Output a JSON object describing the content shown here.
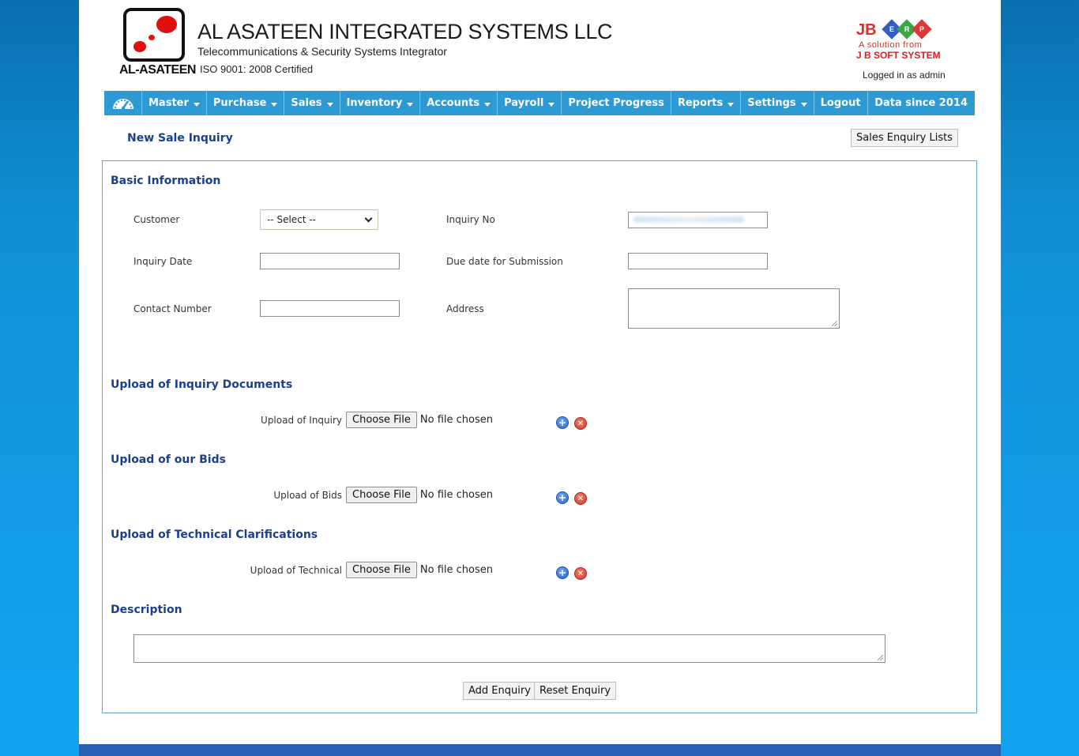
{
  "header": {
    "logo_text": "AL-ASATEEN",
    "company_name": "AL ASATEEN INTEGRATED SYSTEMS LLC",
    "company_tagline": "Telecommunications & Security Systems Integrator",
    "company_iso": "ISO 9001: 2008 Certified",
    "vendor": {
      "brand": "JB",
      "badges": [
        "E",
        "R",
        "P"
      ],
      "line1": "A solution from",
      "line2": "J B SOFT SYSTEM"
    },
    "logged_in_text": "Logged in as admin"
  },
  "nav": {
    "home_icon": "dashboard-icon",
    "items": [
      {
        "label": "Master",
        "dropdown": true
      },
      {
        "label": "Purchase",
        "dropdown": true
      },
      {
        "label": "Sales",
        "dropdown": true
      },
      {
        "label": "Inventory",
        "dropdown": true
      },
      {
        "label": "Accounts",
        "dropdown": true
      },
      {
        "label": "Payroll",
        "dropdown": true
      },
      {
        "label": "Project Progress",
        "dropdown": false
      },
      {
        "label": "Reports",
        "dropdown": true
      },
      {
        "label": "Settings",
        "dropdown": true
      },
      {
        "label": "Logout",
        "dropdown": false
      }
    ],
    "right_text": "Data since 2014"
  },
  "page": {
    "title": "New Sale Inquiry",
    "lists_button": "Sales Enquiry Lists"
  },
  "basic_info": {
    "title": "Basic Information",
    "customer_label": "Customer",
    "customer_selected": "-- Select --",
    "inquiry_no_label": "Inquiry No",
    "inquiry_date_label": "Inquiry Date",
    "due_date_label": "Due date for Submission",
    "contact_label": "Contact Number",
    "address_label": "Address"
  },
  "uploads": [
    {
      "section_title": "Upload of Inquiry Documents",
      "label": "Upload of Inquiry",
      "button": "Choose File",
      "status": "No file chosen"
    },
    {
      "section_title": "Upload of our Bids",
      "label": "Upload of Bids",
      "button": "Choose File",
      "status": "No file chosen"
    },
    {
      "section_title": "Upload of Technical Clarifications",
      "label": "Upload of Technical",
      "button": "Choose File",
      "status": "No file chosen"
    }
  ],
  "description": {
    "title": "Description"
  },
  "actions": {
    "add": "Add Enquiry",
    "reset": "Reset Enquiry"
  },
  "colors": {
    "nav_bg": "#2e9ad3",
    "heading": "#1b3f8f",
    "brand_red": "#e52a2a",
    "background_blue": "#12a4f0"
  }
}
